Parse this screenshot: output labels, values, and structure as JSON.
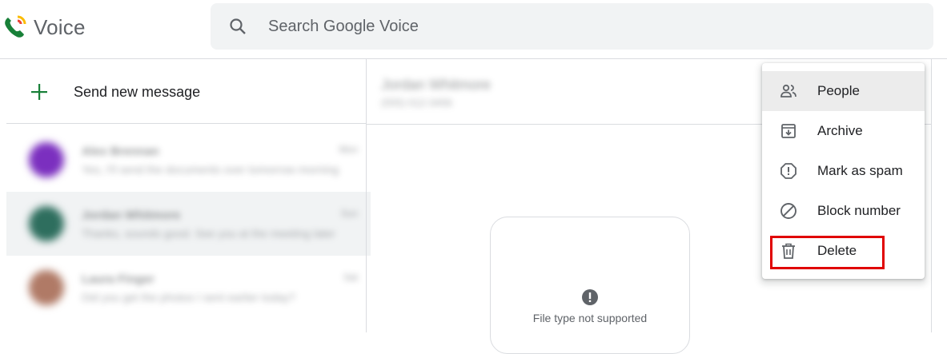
{
  "app": {
    "title": "Voice"
  },
  "search": {
    "placeholder": "Search Google Voice"
  },
  "sidebar": {
    "send_new_label": "Send new message"
  },
  "conversations": [
    {
      "name": "Alex Brennan",
      "snippet": "Yes, I'll send the documents over tomorrow morning",
      "time": "Mon",
      "avatar_color": "#7b2fbf"
    },
    {
      "name": "Jordan Whitmore",
      "snippet": "Thanks, sounds good. See you at the meeting later",
      "time": "Sun",
      "avatar_color": "#2e6e5e"
    },
    {
      "name": "Laura Finger",
      "snippet": "Did you get the photos I sent earlier today?",
      "time": "Sat",
      "avatar_color": "#b07a66"
    }
  ],
  "contact": {
    "name": "Jordan Whitmore",
    "number": "(555) 012-3456"
  },
  "attachment": {
    "message": "File type not supported"
  },
  "menu": {
    "items": [
      {
        "label": "People",
        "icon": "people-icon"
      },
      {
        "label": "Archive",
        "icon": "archive-icon"
      },
      {
        "label": "Mark as spam",
        "icon": "spam-icon"
      },
      {
        "label": "Block number",
        "icon": "block-icon"
      },
      {
        "label": "Delete",
        "icon": "trash-icon"
      }
    ]
  },
  "colors": {
    "accent_green": "#188038",
    "highlight_red": "#e00000",
    "menu_hover": "#ececec"
  }
}
